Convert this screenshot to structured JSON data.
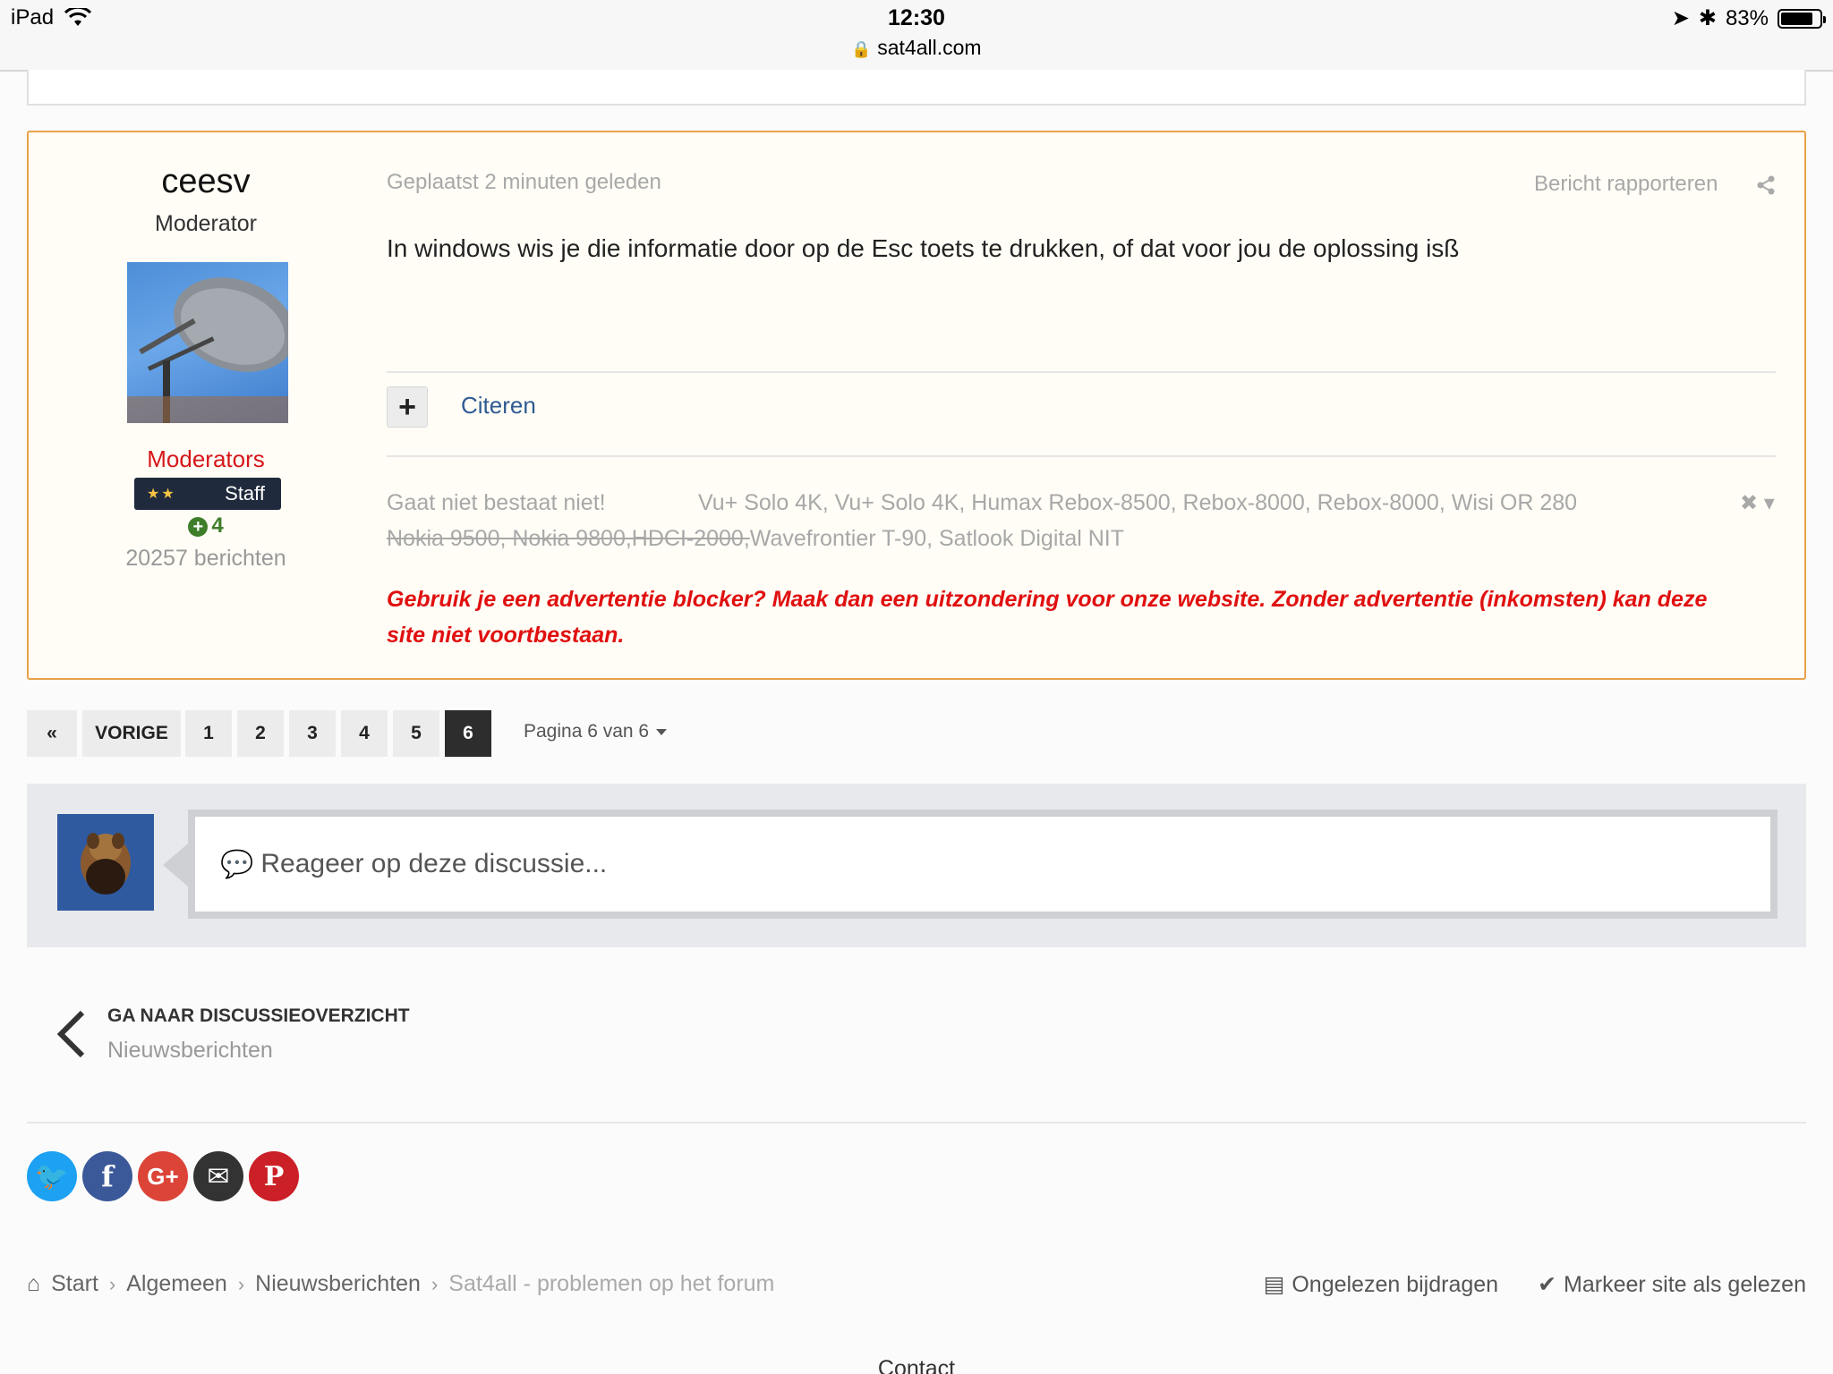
{
  "status_bar": {
    "device": "iPad",
    "time": "12:30",
    "url": "sat4all.com",
    "battery": "83%",
    "battery_level": 0.83
  },
  "post": {
    "author": {
      "name": "ceesv",
      "title": "Moderator",
      "group": "Moderators",
      "badge_label": "Staff",
      "reputation": "4",
      "post_count": "20257 berichten"
    },
    "posted": "Geplaatst 2 minuten geleden",
    "report": "Bericht rapporteren",
    "content": "In windows wis je die informatie door op de Esc toets te drukken, of dat voor jou de oplossing isß",
    "quote_label": "Citeren",
    "signature": {
      "line1": "Gaat niet bestaat niet!",
      "line1b": "Vu+ Solo 4K, Vu+ Solo 4K, Humax Rebox-8500, Rebox-8000, Rebox-8000, Wisi OR 280",
      "line2_strike": "Nokia 9500, Nokia 9800,HDCI-2000,",
      "line2": "Wavefrontier T-90, Satlook Digital NIT"
    },
    "ad_warning": "Gebruik je een advertentie blocker? Maak dan een uitzondering voor onze website. Zonder advertentie (inkomsten) kan deze site niet voortbestaan."
  },
  "pagination": {
    "first_icon": "«",
    "prev_label": "VORIGE",
    "pages": [
      "1",
      "2",
      "3",
      "4",
      "5",
      "6"
    ],
    "current": "6",
    "info": "Pagina 6 van 6"
  },
  "reply": {
    "placeholder": "Reageer op deze discussie..."
  },
  "back_nav": {
    "title": "GA NAAR DISCUSSIEOVERZICHT",
    "subtitle": "Nieuwsberichten"
  },
  "social": [
    {
      "name": "twitter",
      "color": "#1da1f2",
      "glyph": "t"
    },
    {
      "name": "facebook",
      "color": "#3b5998",
      "glyph": "f"
    },
    {
      "name": "google-plus",
      "color": "#db4437",
      "glyph": "G+"
    },
    {
      "name": "email",
      "color": "#333333",
      "glyph": "✉"
    },
    {
      "name": "pinterest",
      "color": "#cb2027",
      "glyph": "P"
    }
  ],
  "breadcrumb": {
    "items": [
      "Start",
      "Algemeen",
      "Nieuwsberichten",
      "Sat4all - problemen op het forum"
    ]
  },
  "footer_links": {
    "unread": "Ongelezen bijdragen",
    "mark_read": "Markeer site als gelezen",
    "contact": "Contact"
  },
  "colors": {
    "post_border": "#e8a24a",
    "group": "#d6161a",
    "link": "#2f5a93",
    "warning": "#e01010"
  }
}
